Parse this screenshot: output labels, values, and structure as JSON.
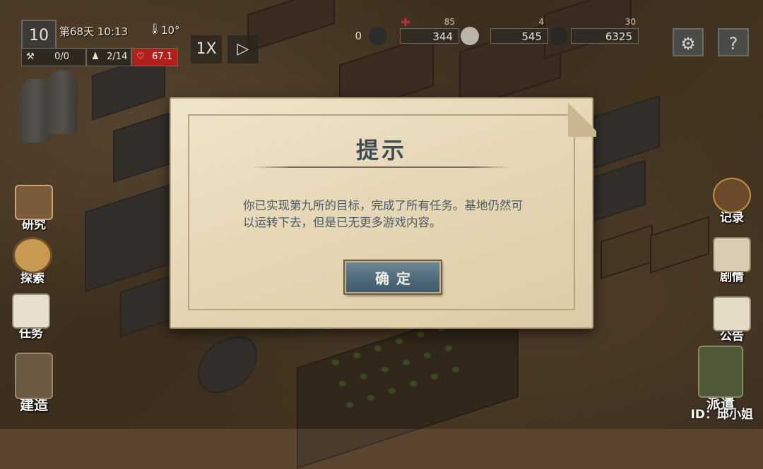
{
  "hud": {
    "day_level": "10",
    "day_time": "第68天 10:13",
    "temperature": "10°",
    "workers": "0/0",
    "residents": "2/14",
    "health": "67.1",
    "speed_label": "1X",
    "play_icon": "play-icon"
  },
  "resources": [
    {
      "value": "0",
      "max": "",
      "icon": "dark-ore-icon"
    },
    {
      "value": "344",
      "max": "85",
      "icon": "red-cross-icon"
    },
    {
      "value": "545",
      "max": "4",
      "icon": "stone-icon"
    },
    {
      "value": "6325",
      "max": "30",
      "icon": "coal-icon"
    }
  ],
  "top_buttons": {
    "settings": "⚙",
    "help": "?"
  },
  "left_menu": [
    {
      "label": "研究",
      "icon": "research-icon"
    },
    {
      "label": "探索",
      "icon": "compass-icon"
    },
    {
      "label": "任务",
      "icon": "task-clipboard-icon"
    },
    {
      "label": "建造",
      "icon": "hammer-icon"
    }
  ],
  "right_menu": [
    {
      "label": "记录",
      "icon": "record-badge-icon"
    },
    {
      "label": "剧情",
      "icon": "story-book-icon"
    },
    {
      "label": "公告",
      "icon": "notice-paper-icon"
    },
    {
      "label": "派遣",
      "icon": "soldier-icon"
    }
  ],
  "dialog": {
    "title": "提示",
    "message": "你已实现第九所的目标，完成了所有任务。基地仍然可以运转下去，但是已无更多游戏内容。",
    "confirm_label": "确定"
  },
  "watermark": "ID：邱小姐",
  "colors": {
    "health_badge": "#b3201c",
    "confirm_button": "#4f6a7b",
    "dialog_paper": "#e6d8b6"
  }
}
